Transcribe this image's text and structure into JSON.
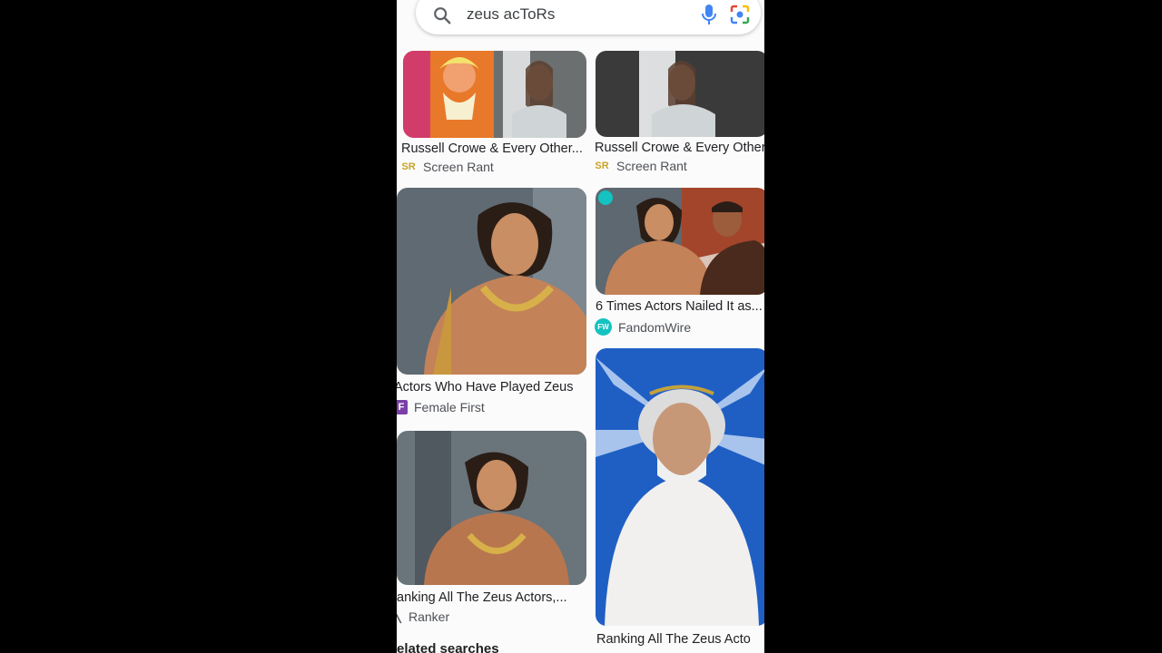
{
  "search": {
    "query": "zeus acToRs"
  },
  "results": [
    {
      "title": "Russell Crowe & Every Other...",
      "source": "Screen Rant",
      "logo": "SR"
    },
    {
      "title": "Russell Crowe & Every Other",
      "source": "Screen Rant",
      "logo": "SR"
    },
    {
      "title": "Actors Who Have Played Zeus",
      "source": "Female First",
      "logo": "F"
    },
    {
      "title": "6 Times Actors Nailed It as...",
      "source": "FandomWire",
      "logo": "FW"
    },
    {
      "title": "anking All The Zeus Actors,...",
      "source": "Ranker",
      "logo": ""
    },
    {
      "title": "Ranking All The Zeus Acto",
      "source": "",
      "logo": ""
    }
  ],
  "footer": {
    "related_label": "elated searches"
  },
  "colors": {
    "screen_rant": "#c9a227",
    "female_first": "#7b3fa8",
    "fandomwire": "#14c2c2"
  }
}
